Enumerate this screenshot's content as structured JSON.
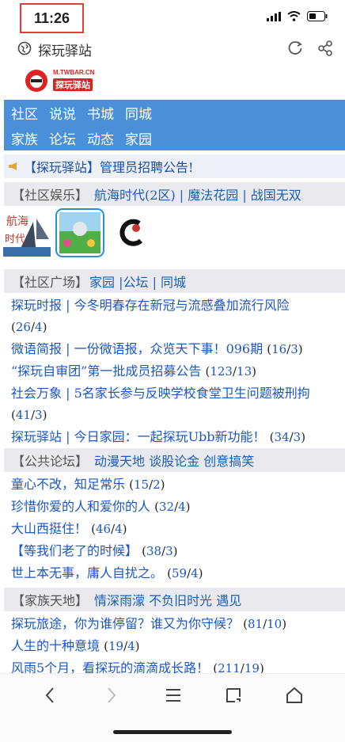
{
  "status": {
    "time": "11:26"
  },
  "toolbar": {
    "title": "探玩驿站"
  },
  "logo": {
    "domain": "M.TWBAR.CN",
    "name": "探玩驿站"
  },
  "nav": {
    "row1": [
      "社区",
      "说说",
      "书城",
      "同城"
    ],
    "row2": [
      "家族",
      "论坛",
      "动态",
      "家园"
    ]
  },
  "announcement": {
    "text": "【探玩驿站】管理员招聘公告!"
  },
  "sections": {
    "entertainment": {
      "label": "【社区娱乐】",
      "links": "航海时代(2区) | 魔法花园 | 战国无双"
    },
    "plaza": {
      "label": "【社区广场】",
      "links": "家园 |公坛 | 同城"
    },
    "forum": {
      "label": "【公共论坛】",
      "links": "动漫天地 谈股论金 创意搞笑"
    },
    "family": {
      "label": "【家族天地】",
      "links": "情深雨濛 不负旧时光 遇见"
    }
  },
  "plaza_posts": [
    {
      "title": "探玩时报 | 今冬明春存在新冠与流感叠加流行风险",
      "count_a": "26",
      "count_b": "4"
    },
    {
      "title": "微语简报 | 一份微语报，众览天下事！096期",
      "count_a": "16",
      "count_b": "3"
    },
    {
      "title": "“探玩自审团”第一批成员招募公告",
      "count_a": "123",
      "count_b": "13"
    },
    {
      "title": "社会万象 | 5名家长参与反映学校食堂卫生问题被刑拘",
      "count_a": "41",
      "count_b": "3"
    },
    {
      "title": "探玩驿站 | 今日家园：一起探玩Ubb新功能！",
      "count_a": "34",
      "count_b": "3"
    }
  ],
  "forum_posts": [
    {
      "title": "童心不改，知足常乐",
      "count_a": "15",
      "count_b": "2"
    },
    {
      "title": "珍惜你爱的人和爱你的人",
      "count_a": "32",
      "count_b": "4"
    },
    {
      "title": "大山西挺住！",
      "count_a": "46",
      "count_b": "4"
    },
    {
      "title": "【等我们老了的时候】",
      "count_a": "38",
      "count_b": "3"
    },
    {
      "title": "世上本无事，庸人自扰之。",
      "count_a": "59",
      "count_b": "4"
    }
  ],
  "family_posts": [
    {
      "title": "探玩旅途，你为谁停留？谁又为你守候？",
      "count_a": "81",
      "count_b": "10"
    },
    {
      "title": "人生的十种意境",
      "count_a": "19",
      "count_b": "4"
    },
    {
      "title": "风雨5个月，看探玩的滴滴成长路！",
      "count_a": "211",
      "count_b": "19"
    }
  ],
  "colors": {
    "nav_bg": "#4a90d9",
    "link": "#1a56c4",
    "section_bg": "#e9e9ee",
    "highlight_border": "#e23b3b"
  }
}
